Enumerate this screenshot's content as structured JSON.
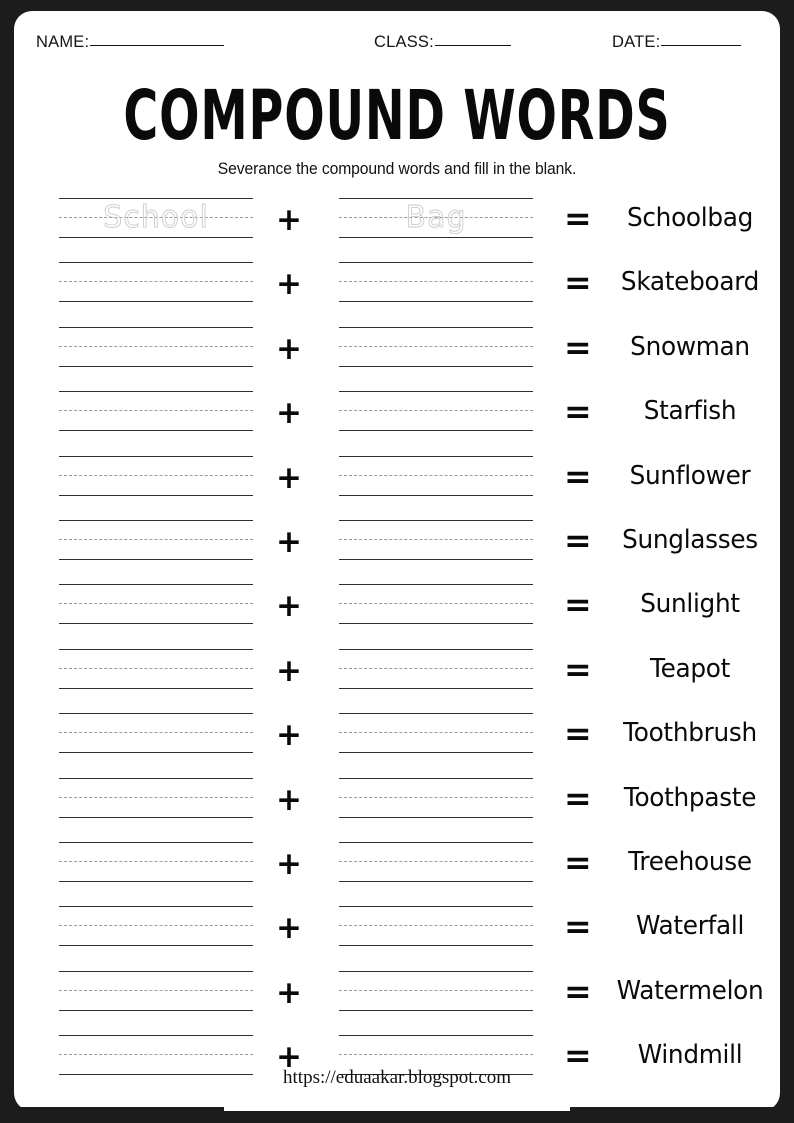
{
  "header": {
    "name_label": "NAME:",
    "class_label": "CLASS:",
    "date_label": "DATE:",
    "name_value": "",
    "class_value": "",
    "date_value": ""
  },
  "title": "COMPOUND WORDS",
  "subtitle": "Severance the compound words and fill in the blank.",
  "operators": {
    "plus": "+",
    "equals": "=",
    "plus_icon": "plus-icon",
    "equals_icon": "equals-icon"
  },
  "rows": [
    {
      "part1": "School",
      "part2": "Bag",
      "answer": "Schoolbag",
      "traced": true
    },
    {
      "part1": "",
      "part2": "",
      "answer": "Skateboard",
      "traced": false
    },
    {
      "part1": "",
      "part2": "",
      "answer": "Snowman",
      "traced": false
    },
    {
      "part1": "",
      "part2": "",
      "answer": "Starfish",
      "traced": false
    },
    {
      "part1": "",
      "part2": "",
      "answer": "Sunflower",
      "traced": false
    },
    {
      "part1": "",
      "part2": "",
      "answer": "Sunglasses",
      "traced": false
    },
    {
      "part1": "",
      "part2": "",
      "answer": "Sunlight",
      "traced": false
    },
    {
      "part1": "",
      "part2": "",
      "answer": "Teapot",
      "traced": false
    },
    {
      "part1": "",
      "part2": "",
      "answer": "Toothbrush",
      "traced": false
    },
    {
      "part1": "",
      "part2": "",
      "answer": "Toothpaste",
      "traced": false
    },
    {
      "part1": "",
      "part2": "",
      "answer": "Treehouse",
      "traced": false
    },
    {
      "part1": "",
      "part2": "",
      "answer": "Waterfall",
      "traced": false
    },
    {
      "part1": "",
      "part2": "",
      "answer": "Watermelon",
      "traced": false
    },
    {
      "part1": "",
      "part2": "",
      "answer": "Windmill",
      "traced": false
    }
  ],
  "footer": {
    "url": "https://eduaakar.blogspot.com"
  },
  "colors": {
    "frame": "#1c1c1c",
    "paper": "#ffffff",
    "ink": "#0a0a0a",
    "rule": "#2e2e2e",
    "dashed_rule": "#9a9a9a",
    "trace": "#c9c9c9"
  }
}
